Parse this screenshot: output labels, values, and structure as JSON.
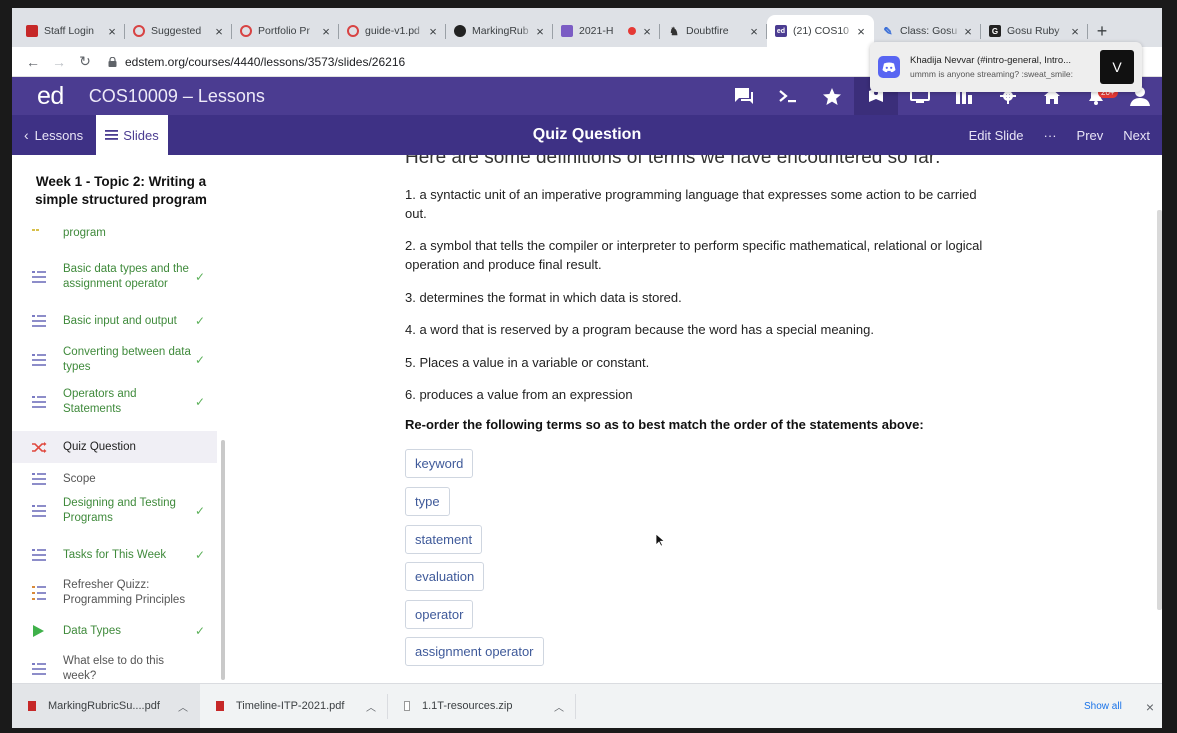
{
  "browser": {
    "tabs": [
      {
        "title": "Staff Login",
        "icon": "flag-icon",
        "color": "#c62828"
      },
      {
        "title": "Suggested",
        "icon": "swirl-icon",
        "color": "#d84343"
      },
      {
        "title": "Portfolio Pr",
        "icon": "swirl-icon",
        "color": "#d84343"
      },
      {
        "title": "guide-v1.pd",
        "icon": "swirl-icon",
        "color": "#d84343"
      },
      {
        "title": "MarkingRub",
        "icon": "github-icon",
        "color": "#222222"
      },
      {
        "title": "2021-H",
        "icon": "doc-icon",
        "color": "#7b5cc4"
      },
      {
        "title": "Doubtfire",
        "icon": "doubtfire-icon",
        "color": "#333333"
      },
      {
        "title": "(21) COS10",
        "icon": "ed-icon",
        "color": "#4b3c91"
      },
      {
        "title": "Class: Gosu",
        "icon": "class-icon",
        "color": "#3b6fd8"
      },
      {
        "title": "Gosu Ruby",
        "icon": "g-icon",
        "color": "#222222"
      }
    ],
    "url": "edstem.org/courses/4440/lessons/3573/slides/26216"
  },
  "notification": {
    "title": "Khadija Nevvar (#intro-general, Intro...",
    "message": "ummm is anyone streaming? :sweat_smile:",
    "action": "V"
  },
  "header": {
    "logo": "ed",
    "course": "COS10009 – Lessons",
    "notif_badge": "20+"
  },
  "subheader": {
    "back": "Lessons",
    "slides": "Slides",
    "title": "Quiz Question",
    "edit": "Edit Slide",
    "more": "···",
    "prev": "Prev",
    "next": "Next"
  },
  "sidebar": {
    "title": "Week 1 - Topic 2: Writing a simple structured program",
    "items": [
      {
        "label": "program",
        "icon": "list-icon",
        "done": false
      },
      {
        "label": "Basic data types and the assignment operator",
        "icon": "list-icon",
        "done": true
      },
      {
        "label": "Basic input and output",
        "icon": "list-icon",
        "done": true
      },
      {
        "label": "Converting between data types",
        "icon": "list-icon",
        "done": true
      },
      {
        "label": "Operators and Statements",
        "icon": "list-icon",
        "done": true
      },
      {
        "label": "Quiz Question",
        "icon": "shuffle-icon",
        "done": false
      },
      {
        "label": "Scope",
        "icon": "list-icon",
        "done": false
      },
      {
        "label": "Designing and Testing Programs",
        "icon": "list-icon",
        "done": true
      },
      {
        "label": "Tasks for This Week",
        "icon": "list-icon",
        "done": true
      },
      {
        "label": "Refresher Quizz: Programming Principles",
        "icon": "quiz-icon",
        "done": false
      },
      {
        "label": "Data Types",
        "icon": "play-icon",
        "done": true
      },
      {
        "label": "What else to do this week?",
        "icon": "list-icon",
        "done": false
      }
    ],
    "check": "✓"
  },
  "content": {
    "heading": "Here are some definitions of terms we have encountered so far:",
    "statements": [
      "1. a syntactic unit of an imperative programming language that expresses some action to be carried out.",
      "2. a symbol that tells the compiler or interpreter to perform specific mathematical, relational or logical operation and produce final result.",
      "3. determines the format in which data is stored.",
      "4. a word that is reserved by a program because the word has a special meaning.",
      "5. Places a value in a variable or constant.",
      "6. produces a value from an expression"
    ],
    "instruction": "Re-order the following terms so as to best match the order of the statements above:",
    "terms": [
      "keyword",
      "type",
      "statement",
      "evaluation",
      "operator",
      "assignment operator"
    ]
  },
  "downloads": {
    "files": [
      {
        "name": "MarkingRubricSu....pdf",
        "color": "#c62828"
      },
      {
        "name": "Timeline-ITP-2021.pdf",
        "color": "#c62828"
      },
      {
        "name": "1.1T-resources.zip",
        "color": "#777777"
      }
    ],
    "show_all": "Show all",
    "close": "×"
  },
  "colors": {
    "ed_purple": "#4b3c91",
    "ed_purple_dark": "#3e3185",
    "done_green": "#3f8a3b",
    "chip_text": "#3f5a9a"
  }
}
